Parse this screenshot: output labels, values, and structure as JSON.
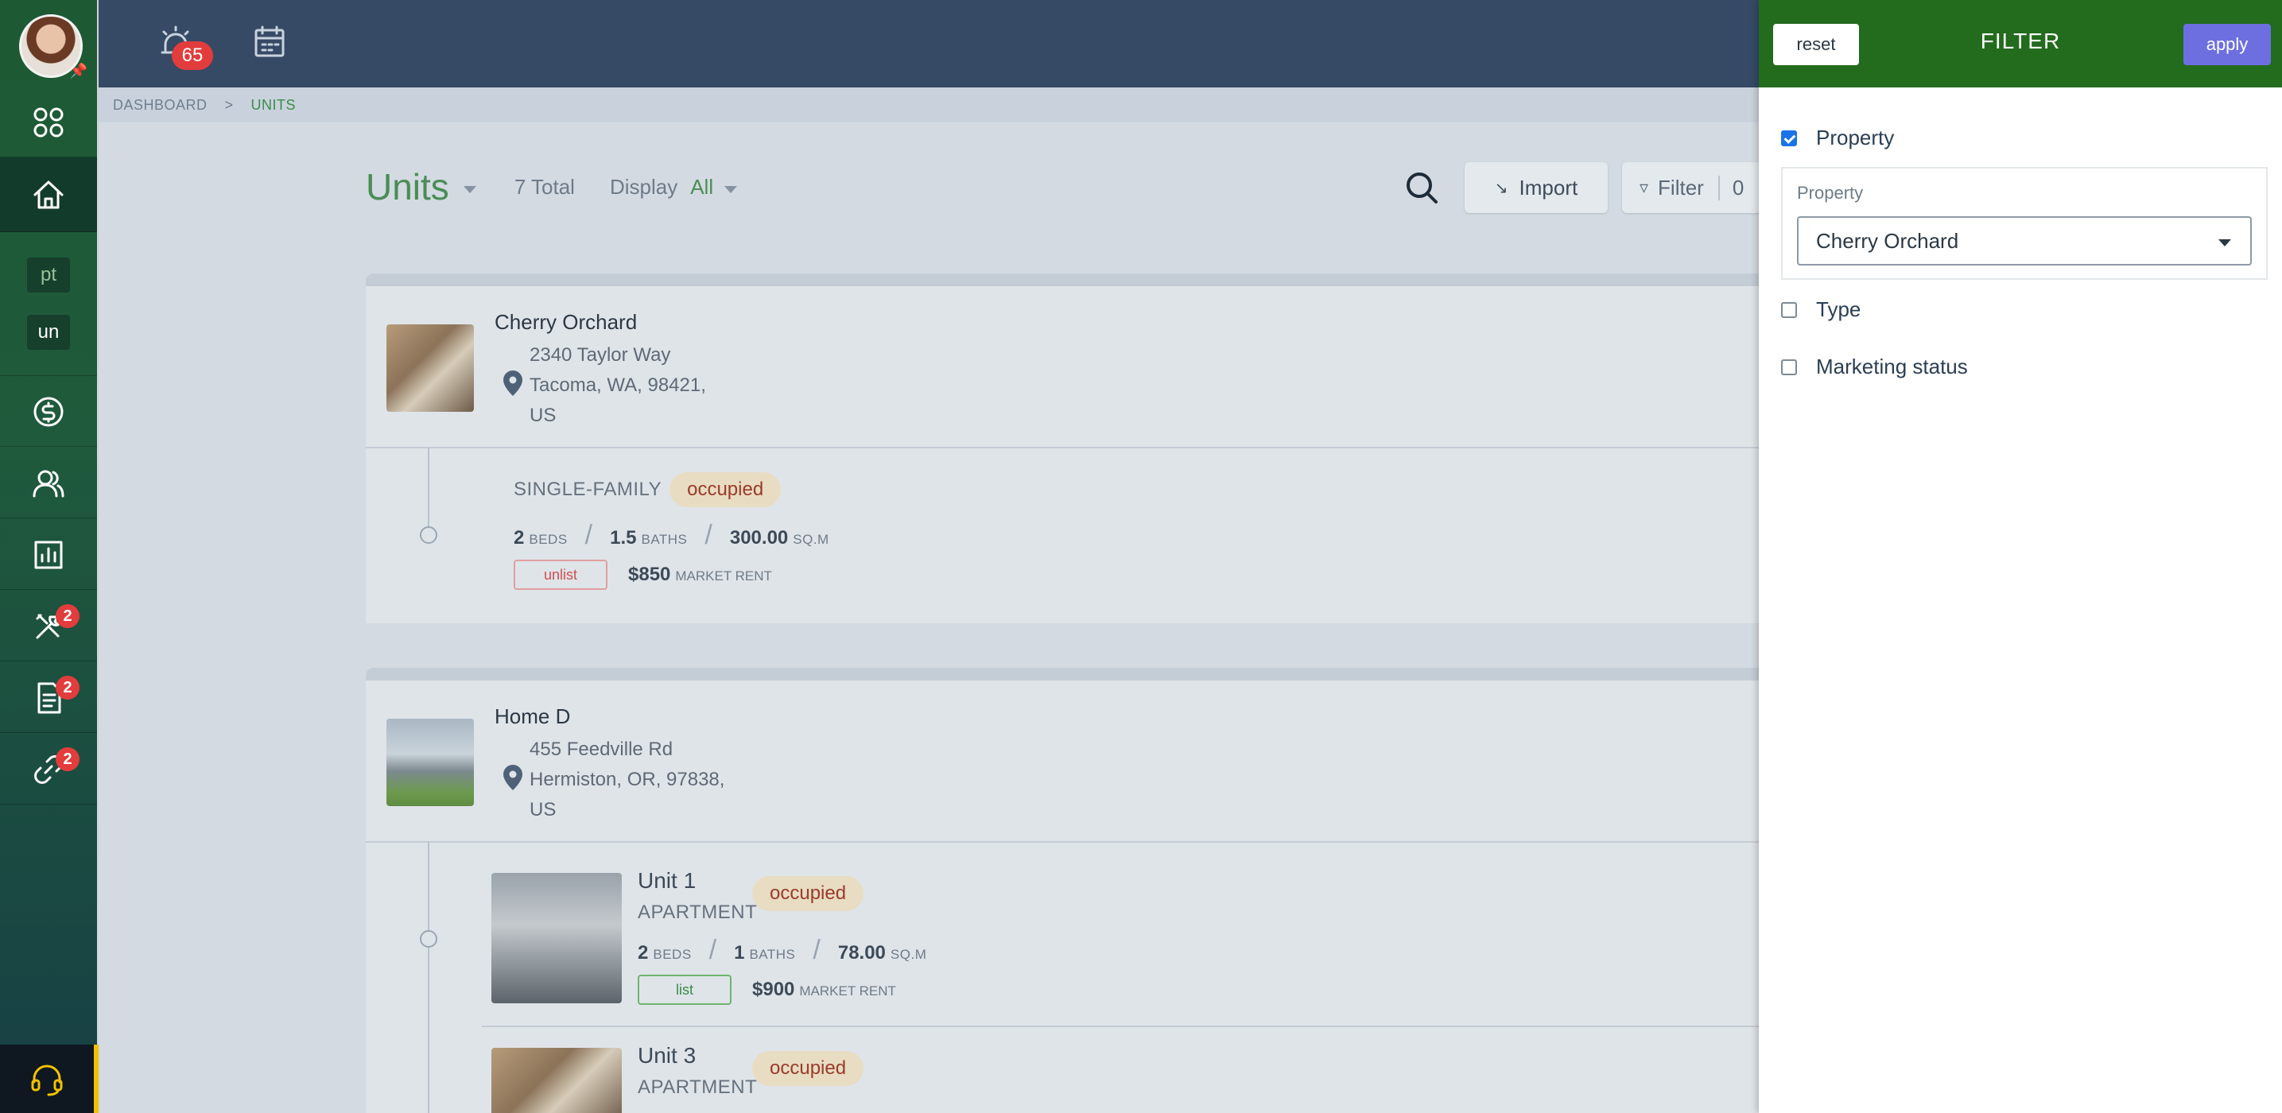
{
  "sidebar": {
    "text_items": [
      "pt",
      "un"
    ],
    "badges": {
      "maintenance": "2",
      "documents": "2",
      "links": "2"
    }
  },
  "topbar": {
    "alarm_badge": "65"
  },
  "breadcrumb": {
    "root": "DASHBOARD",
    "separator": ">",
    "current": "UNITS"
  },
  "toolbar": {
    "title": "Units",
    "total": "7 Total",
    "display_label": "Display",
    "display_value": "All",
    "import_label": "Import",
    "filter_label": "Filter",
    "filter_count": "0"
  },
  "properties": [
    {
      "name": "Cherry Orchard",
      "address": [
        "2340 Taylor Way",
        "Tacoma, WA, 98421,",
        "US"
      ],
      "units": [
        {
          "title": "",
          "type": "SINGLE-FAMILY",
          "status": "occupied",
          "beds": "2",
          "baths": "1.5",
          "area": "300.00",
          "listing": "unlist",
          "rent": "$850"
        }
      ]
    },
    {
      "name": "Home D",
      "address": [
        "455 Feedville Rd",
        "Hermiston, OR, 97838,",
        "US"
      ],
      "units": [
        {
          "title": "Unit 1",
          "type": "APARTMENT",
          "status": "occupied",
          "beds": "2",
          "baths": "1",
          "area": "78.00",
          "listing": "list",
          "rent": "$900"
        },
        {
          "title": "Unit 3",
          "type": "APARTMENT",
          "status": "occupied"
        }
      ]
    }
  ],
  "labels": {
    "beds": "BEDS",
    "baths": "BATHS",
    "area_unit": "SQ.M",
    "market_rent": "MARKET RENT"
  },
  "filter_panel": {
    "title": "FILTER",
    "reset_label": "reset",
    "apply_label": "apply",
    "property_checkbox": "Property",
    "property_field_label": "Property",
    "property_value": "Cherry Orchard",
    "type_checkbox": "Type",
    "marketing_checkbox": "Marketing status",
    "property_checked": true,
    "type_checked": false,
    "marketing_checked": false
  },
  "colors": {
    "brand_green": "#236b1d",
    "apply_purple": "#6d6fe0",
    "topbar": "#364a66",
    "badge_red": "#e23c3c"
  }
}
